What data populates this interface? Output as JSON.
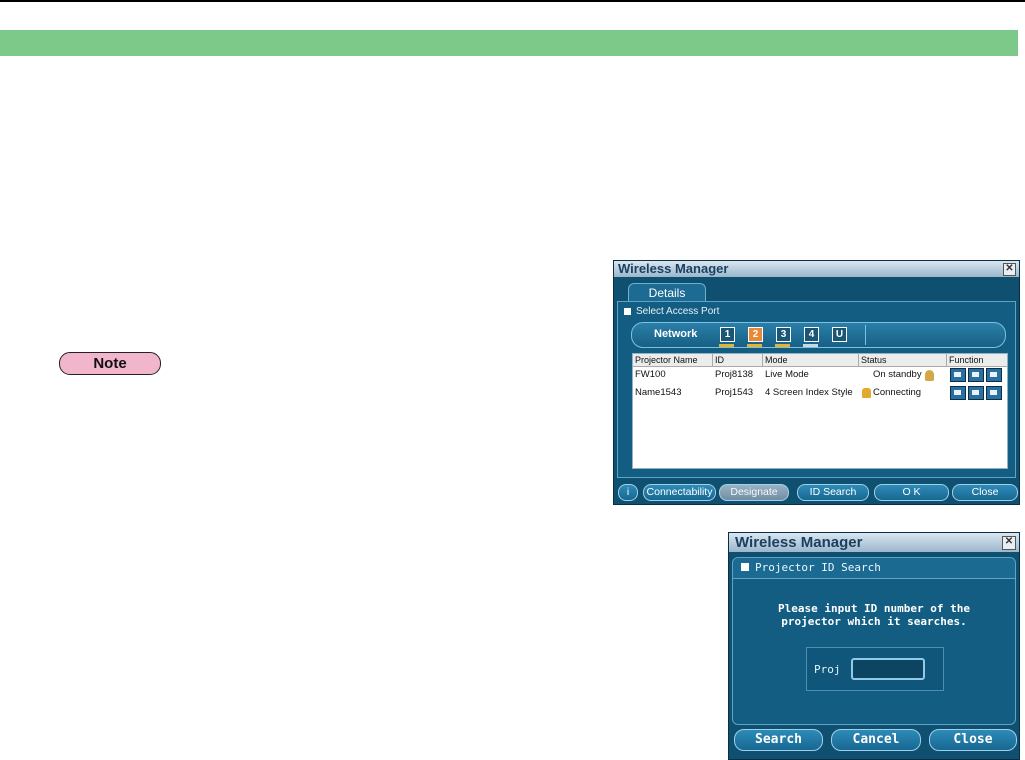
{
  "page": {
    "note_label": "Note"
  },
  "win1": {
    "title": "Wireless Manager",
    "close_glyph": "✕",
    "tab_details": "Details",
    "select_access_port": "Select Access Port",
    "network_label": "Network",
    "networks": [
      "1",
      "2",
      "3",
      "4",
      "U"
    ],
    "active_network": "2",
    "columns": [
      "Projector Name",
      "ID",
      "Mode",
      "Status",
      "Function"
    ],
    "rows": [
      {
        "name": "FW100",
        "id": "Proj8138",
        "mode": "Live Mode",
        "status": "On standby"
      },
      {
        "name": "Name1543",
        "id": "Proj1543",
        "mode": "4 Screen Index Style",
        "status": "Connecting"
      }
    ],
    "buttons": {
      "info": "i",
      "connectability": "Connectability",
      "designate": "Designate",
      "id_search": "ID Search",
      "ok": "O K",
      "close": "Close"
    }
  },
  "win2": {
    "title": "Wireless Manager",
    "close_glyph": "✕",
    "section": "Projector ID Search",
    "message_line1": "Please input ID number of the",
    "message_line2": "projector which it searches.",
    "proj_label": "Proj",
    "proj_value": "",
    "buttons": {
      "search": "Search",
      "cancel": "Cancel",
      "close": "Close"
    }
  },
  "colors": {
    "green_bar": "#7dc98a",
    "note_badge": "#f2b6cc",
    "window_bg": "#0f4f70",
    "active_network": "#e8893a"
  },
  "icons": [
    "lock-icon",
    "person-icon",
    "function-icons"
  ]
}
